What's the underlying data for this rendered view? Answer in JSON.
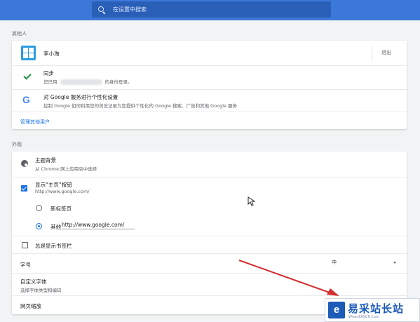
{
  "search": {
    "placeholder": "在设置中搜索",
    "icon": "search-icon"
  },
  "people": {
    "section_title": "其他人",
    "user": {
      "name": "李小淘",
      "signout_label": "退出",
      "icon": "windows-logo-icon"
    },
    "sync": {
      "title": "同步",
      "desc_prefix": "您已用",
      "desc_suffix": "的身份登录。",
      "icon": "check-icon"
    },
    "personalize": {
      "title": "对 Google 服务进行个性化设置",
      "desc": "控制 Google 如何利用您的浏览记录为您提供个性化的 Google 搜索、广告和其他 Google 服务",
      "icon": "google-logo-icon",
      "logo_text": "G"
    },
    "manage_link": "管理其他用户"
  },
  "appearance": {
    "section_title": "外观",
    "theme": {
      "title": "主题背景",
      "desc": "从 Chrome 网上应用店中选择",
      "icon": "palette-icon"
    },
    "home_button": {
      "title": "显示“主页”按钮",
      "desc": "http://www.google.com/",
      "checked": true
    },
    "home_options": [
      {
        "label": "新标签页",
        "selected": false
      },
      {
        "label": "其他",
        "value": "http://www.google.com/",
        "selected": true
      }
    ],
    "bookmarks_bar": {
      "title": "总是显示书签栏",
      "checked": false
    },
    "font_size": {
      "label": "字号",
      "value": "中"
    },
    "custom_fonts": {
      "title": "自定义字体",
      "desc": "选择字体类型和编码"
    },
    "page_zoom": {
      "label": "网页缩放"
    }
  },
  "annotation": {
    "arrow_color": "#d32f2f"
  },
  "watermark": {
    "logo": "e",
    "title": "易采站长站",
    "subtitle": "Www.EASCK.Com"
  },
  "colors": {
    "accent": "#1a73e8",
    "topbar": "#3c78d8",
    "background": "#f1f3f4"
  }
}
